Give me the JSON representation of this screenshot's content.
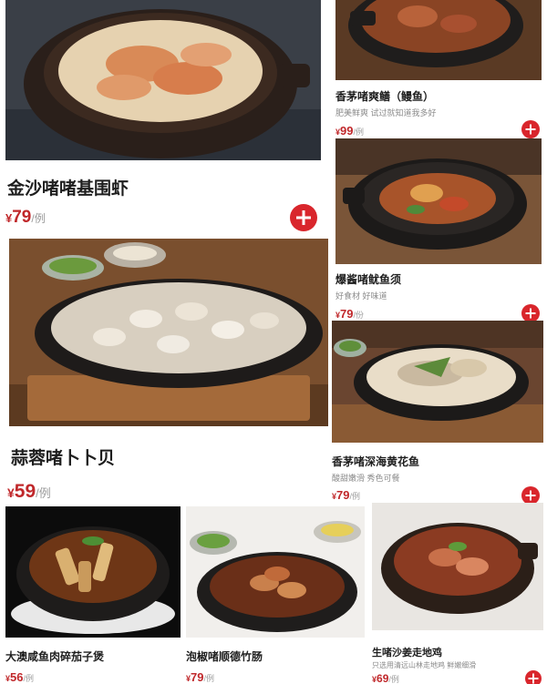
{
  "theme": {
    "accent": "#d9262c",
    "price_color": "#c0282b"
  },
  "currency": "¥",
  "dishes": [
    {
      "name": "金沙啫啫基围虾",
      "subtitle": "",
      "price": "79",
      "unit": "/例",
      "add_icon": "plus-icon"
    },
    {
      "name": "香茅啫爽鳝（鳗鱼）",
      "subtitle": "肥美鲜爽 试过就知道我多好",
      "price": "99",
      "unit": "/例",
      "add_icon": "plus-icon"
    },
    {
      "name": "爆酱啫鱿鱼须",
      "subtitle": "好食材 好味道",
      "price": "79",
      "unit": "/份",
      "add_icon": "plus-icon"
    },
    {
      "name": "蒜蓉啫卜卜贝",
      "subtitle": "",
      "price": "59",
      "unit": "/例",
      "add_icon": "plus-icon"
    },
    {
      "name": "香茅啫深海黄花鱼",
      "subtitle": "酸甜嫩滑 秀色可餐",
      "price": "79",
      "unit": "/例",
      "add_icon": "plus-icon"
    },
    {
      "name": "大澳咸鱼肉碎茄子煲",
      "subtitle": "",
      "price": "56",
      "unit": "/例",
      "add_icon": "plus-icon"
    },
    {
      "name": "泡椒啫顺德竹肠",
      "subtitle": "",
      "price": "79",
      "unit": "/例",
      "add_icon": "plus-icon"
    },
    {
      "name": "生啫沙姜走地鸡",
      "subtitle": "只选用清远山林走地鸡 鲜嫩细滑",
      "price": "69",
      "unit": "/例",
      "add_icon": "plus-icon"
    }
  ]
}
